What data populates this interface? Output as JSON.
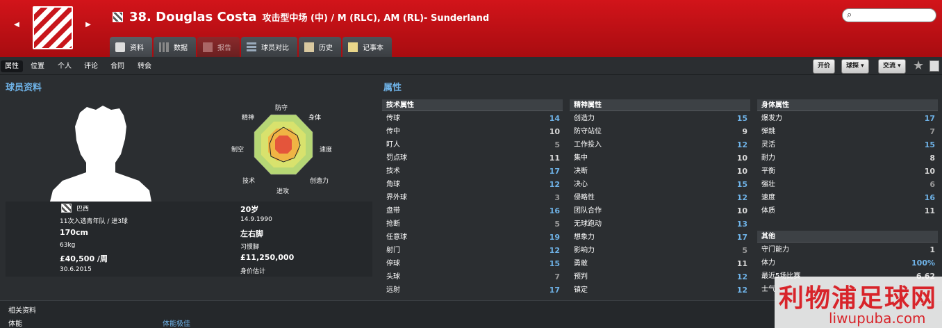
{
  "header": {
    "player_name": "38. Douglas Costa",
    "position_text": "攻击型中场 (中) / M (RLC), AM (RL)- Sunderland",
    "search_placeholder": ""
  },
  "tabs": [
    {
      "label": "资料",
      "active": true
    },
    {
      "label": "数据",
      "active": false
    },
    {
      "label": "报告",
      "active": false
    },
    {
      "label": "球员对比",
      "active": false
    },
    {
      "label": "历史",
      "active": false
    },
    {
      "label": "记事本",
      "active": false
    }
  ],
  "subtabs": [
    "属性",
    "位置",
    "个人",
    "评论",
    "合同",
    "转会"
  ],
  "action_buttons": {
    "offer": "开价",
    "club": "球探",
    "interact": "交流"
  },
  "sections": {
    "profile": "球员资料",
    "attributes": "属性"
  },
  "radar_labels": {
    "defending": "防守",
    "physical": "身体",
    "speed": "速度",
    "creativity": "创造力",
    "attacking": "进攻",
    "technique": "技术",
    "aerial": "制空",
    "mental": "精神"
  },
  "profile": {
    "nationality": "巴西",
    "caps": "11次入选青年队 / 进3球",
    "height": "170cm",
    "weight": "63kg",
    "wage": "£40,500 /周",
    "contract_end": "30.6.2015",
    "age": "20岁",
    "dob": "14.9.1990",
    "foot": "左右脚",
    "foot_sub": "习惯脚",
    "value": "£11,250,000",
    "value_label": "身价估计"
  },
  "technical": {
    "title": "技术属性",
    "rows": [
      {
        "label": "传球",
        "value": "14",
        "tier": "hi"
      },
      {
        "label": "传中",
        "value": "10",
        "tier": "mid"
      },
      {
        "label": "盯人",
        "value": "5",
        "tier": "lo"
      },
      {
        "label": "罚点球",
        "value": "11",
        "tier": "mid"
      },
      {
        "label": "技术",
        "value": "17",
        "tier": "hi"
      },
      {
        "label": "角球",
        "value": "12",
        "tier": "hi"
      },
      {
        "label": "界外球",
        "value": "3",
        "tier": "lo"
      },
      {
        "label": "盘带",
        "value": "16",
        "tier": "hi"
      },
      {
        "label": "抢断",
        "value": "5",
        "tier": "lo"
      },
      {
        "label": "任意球",
        "value": "19",
        "tier": "hi"
      },
      {
        "label": "射门",
        "value": "12",
        "tier": "hi"
      },
      {
        "label": "停球",
        "value": "15",
        "tier": "hi"
      },
      {
        "label": "头球",
        "value": "7",
        "tier": "lo"
      },
      {
        "label": "远射",
        "value": "17",
        "tier": "hi"
      }
    ]
  },
  "mental": {
    "title": "精神属性",
    "rows": [
      {
        "label": "创造力",
        "value": "15",
        "tier": "hi"
      },
      {
        "label": "防守站位",
        "value": "9",
        "tier": "mid"
      },
      {
        "label": "工作投入",
        "value": "12",
        "tier": "hi"
      },
      {
        "label": "集中",
        "value": "10",
        "tier": "mid"
      },
      {
        "label": "决断",
        "value": "10",
        "tier": "mid"
      },
      {
        "label": "决心",
        "value": "15",
        "tier": "hi"
      },
      {
        "label": "侵略性",
        "value": "12",
        "tier": "hi"
      },
      {
        "label": "团队合作",
        "value": "10",
        "tier": "mid"
      },
      {
        "label": "无球跑动",
        "value": "13",
        "tier": "hi"
      },
      {
        "label": "想象力",
        "value": "17",
        "tier": "hi"
      },
      {
        "label": "影响力",
        "value": "5",
        "tier": "lo"
      },
      {
        "label": "勇敢",
        "value": "11",
        "tier": "mid"
      },
      {
        "label": "预判",
        "value": "12",
        "tier": "hi"
      },
      {
        "label": "镇定",
        "value": "12",
        "tier": "hi"
      }
    ]
  },
  "physical": {
    "title": "身体属性",
    "rows": [
      {
        "label": "爆发力",
        "value": "17",
        "tier": "hi"
      },
      {
        "label": "弹跳",
        "value": "7",
        "tier": "lo"
      },
      {
        "label": "灵活",
        "value": "15",
        "tier": "hi"
      },
      {
        "label": "耐力",
        "value": "8",
        "tier": "mid"
      },
      {
        "label": "平衡",
        "value": "10",
        "tier": "mid"
      },
      {
        "label": "强壮",
        "value": "6",
        "tier": "lo"
      },
      {
        "label": "速度",
        "value": "16",
        "tier": "hi"
      },
      {
        "label": "体质",
        "value": "11",
        "tier": "mid"
      }
    ]
  },
  "other": {
    "title": "其他",
    "rows": [
      {
        "label": "守门能力",
        "value": "1",
        "tier": "mid"
      },
      {
        "label": "体力",
        "value": "100%",
        "tier": "hi"
      },
      {
        "label": "最近5场比赛",
        "value": "6.62",
        "tier": "mid"
      },
      {
        "label": "士气",
        "value": "",
        "tier": "mid"
      }
    ]
  },
  "related": {
    "title": "相关资料",
    "col1": "体能",
    "col2": "体能极佳"
  },
  "watermark": {
    "line1": "利物浦足球网",
    "line2": "liwupuba.com"
  }
}
